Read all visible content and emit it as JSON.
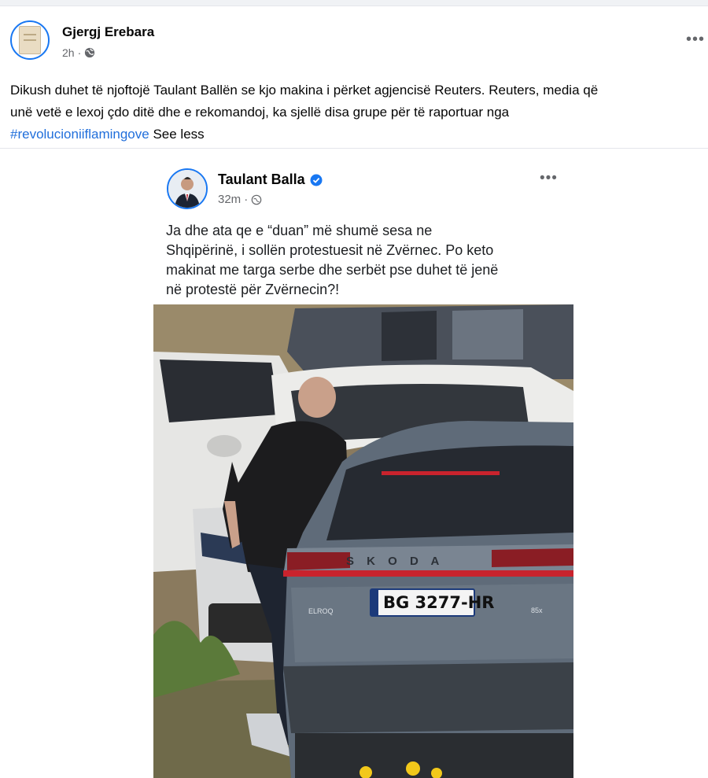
{
  "post": {
    "author": "Gjergj Erebara",
    "time": "2h",
    "text_main": "Dikush duhet të njoftojë Taulant Ballën se kjo makina i përket agjencisë Reuters. Reuters, media që\nunë vetë e lexoj çdo ditë dhe e rekomandoj, ka sjellë disa grupe për të raportuar nga\n",
    "hashtag": "#revolucioniiflamingove",
    "see_less": "See less",
    "more_icon": "more-horizontal-icon",
    "privacy_icon": "globe-icon"
  },
  "shared": {
    "author": "Taulant Balla",
    "time": "32m",
    "text": "Ja dhe ata qe e “duan” më shumë sesa ne\nShqipërinë, i sollën protestuesit në Zvërnec. Po keto\nmakinat me targa serbe dhe serbët pse duhet të jenë\nnë protestë për Zvërnecin?!",
    "badge_icon": "verified-badge-icon",
    "photo": {
      "brand": "S K O D A",
      "plate": "BG  3277-HR",
      "badge_left": "ELROQ",
      "badge_right": "85x"
    }
  },
  "colors": {
    "accent": "#1877f2",
    "hashtag": "#216fdb",
    "secondary_text": "#65676b"
  }
}
